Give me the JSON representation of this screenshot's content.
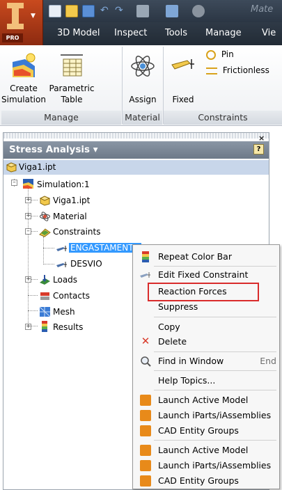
{
  "app": {
    "logo_badge": "PRO"
  },
  "quick_access": {
    "search_placeholder": "Mate"
  },
  "ribbon_tabs": [
    "3D Model",
    "Inspect",
    "Tools",
    "Manage",
    "Vie"
  ],
  "ribbon": {
    "buttons": {
      "create_simulation": [
        "Create",
        "Simulation"
      ],
      "parametric_table": [
        "Parametric",
        "Table"
      ],
      "assign": "Assign",
      "fixed": "Fixed",
      "pin": "Pin",
      "frictionless": "Frictionless"
    },
    "groups": {
      "manage": "Manage",
      "material": "Material",
      "constraints": "Constraints"
    }
  },
  "browser": {
    "title": "Stress Analysis ▾",
    "close_glyph": "×",
    "help_glyph": "?",
    "root": "Viga1.ipt",
    "tree": {
      "simulation": "Simulation:1",
      "part": "Viga1.ipt",
      "material": "Material",
      "constraints": "Constraints",
      "engastamento": "ENGASTAMENTO",
      "desvio": "DESVIO",
      "loads": "Loads",
      "contacts": "Contacts",
      "mesh": "Mesh",
      "results": "Results"
    }
  },
  "context_menu": {
    "items": {
      "repeat_color_bar": "Repeat Color Bar",
      "edit_fixed_constraint": "Edit Fixed Constraint",
      "reaction_forces": "Reaction Forces",
      "suppress": "Suppress",
      "copy": "Copy",
      "delete": "Delete",
      "find_in_window": "Find in Window",
      "find_shortcut": "End",
      "help_topics": "Help Topics...",
      "launch_active_model_1": "Launch Active Model",
      "launch_iparts_1": "Launch iParts/iAssemblies",
      "cad_entity_groups_1": "CAD Entity Groups",
      "launch_active_model_2": "Launch Active Model",
      "launch_iparts_2": "Launch iParts/iAssemblies",
      "cad_entity_groups_2": "CAD Entity Groups"
    }
  },
  "colors": {
    "highlight_red": "#d92b2b",
    "selection_blue": "#3399ff",
    "ribbon_dark": "#2b3644"
  }
}
